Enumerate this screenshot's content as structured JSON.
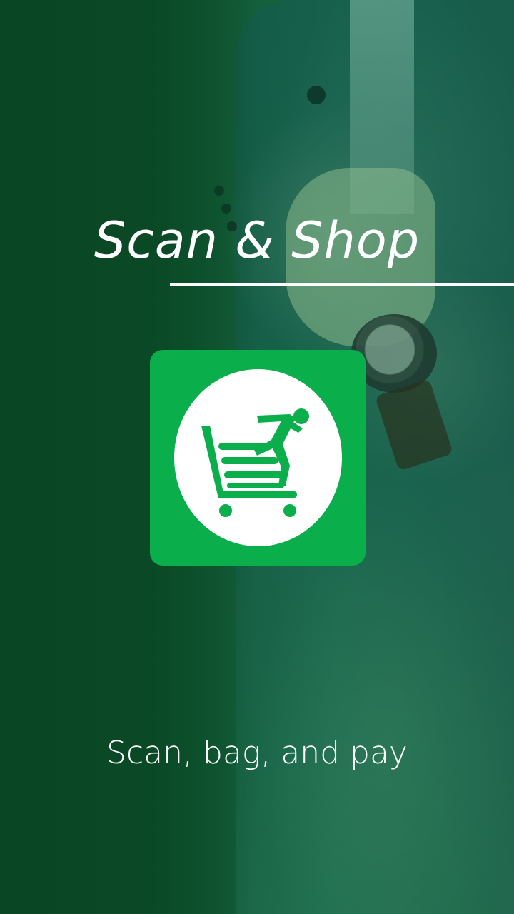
{
  "splash": {
    "title": "Scan & Shop",
    "tagline": "Scan, bag, and pay",
    "logo_icon": "shopping-cart-runner-icon"
  },
  "colors": {
    "brand_green": "#0aae4a",
    "overlay_green": "#0f4f2c",
    "text": "#ffffff"
  }
}
